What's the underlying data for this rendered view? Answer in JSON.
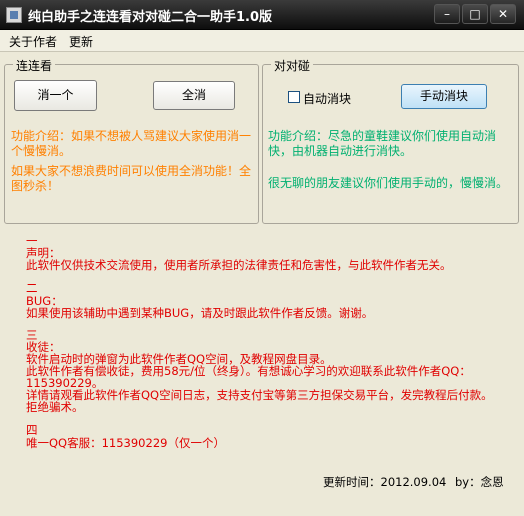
{
  "window": {
    "title": "纯白助手之连连看对对碰二合一助手1.0版",
    "minimize": "–",
    "maximize": "□",
    "close": "✕"
  },
  "menu": {
    "about": "关于作者",
    "update": "更新"
  },
  "lianliankan": {
    "legend": "连连看",
    "clear_one_label": "消一个",
    "clear_all_label": "全消",
    "intro": "功能介绍：如果不想被人骂建议大家使用消一个慢慢消。",
    "tip": "如果大家不想浪费时间可以使用全消功能！全图秒杀！"
  },
  "duiduipeng": {
    "legend": "对对碰",
    "auto_label": "自动消块",
    "auto_checked": false,
    "manual_label": "手动消块",
    "intro": "功能介绍：尽急的童鞋建议你们使用自动消快，由机器自动进行消快。",
    "tip": "很无聊的朋友建议你们使用手动的，慢慢消。"
  },
  "notice": {
    "s1_num": "一",
    "s1_title": "声明：",
    "s1_line1": "此软件仅供技术交流使用，使用者所承担的法律责任和危害性，与此软件作者无关。",
    "s2_num": "二",
    "s2_title": "BUG：",
    "s2_line1": "如果使用该辅助中遇到某种BUG，请及时跟此软件作者反馈。谢谢。",
    "s3_num": "三",
    "s3_title": "收徒：",
    "s3_line1": "软件启动时的弹窗为此软件作者QQ空间，及教程网盘目录。",
    "s3_line2": "此软件作者有偿收徒，费用58元/位（终身）。有想诚心学习的欢迎联系此软件作者QQ：",
    "s3_line3": "115390229。",
    "s3_line4": "详情请观看此软件作者QQ空间日志，支持支付宝等第三方担保交易平台，发完教程后付款。",
    "s3_line5": "拒绝骗术。",
    "s4_num": "四",
    "s4_line1": "唯一QQ客服：115390229（仅一个）"
  },
  "footer": {
    "update_time": "更新时间：2012.09.04",
    "author": "by：念恩"
  }
}
